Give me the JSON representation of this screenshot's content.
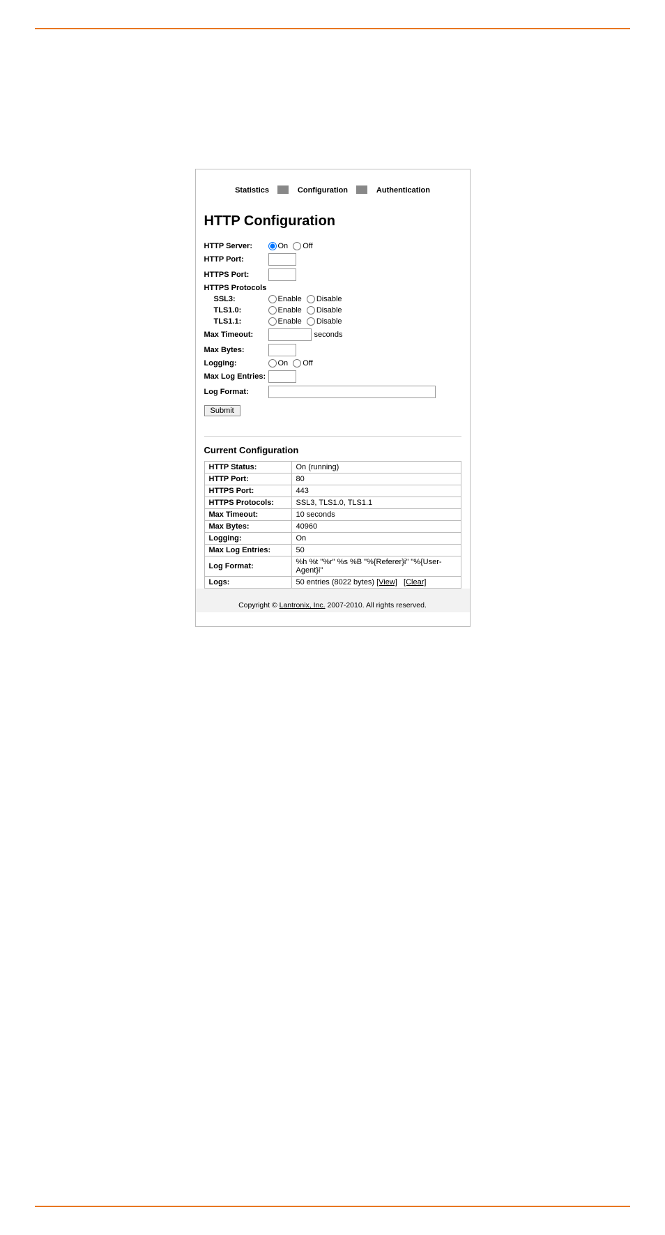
{
  "tabs": {
    "t1": "Statistics",
    "t2": "Configuration",
    "t3": "Authentication"
  },
  "heading": "HTTP Configuration",
  "form": {
    "http_server": {
      "label": "HTTP Server:",
      "on": "On",
      "off": "Off"
    },
    "http_port": {
      "label": "HTTP Port:",
      "value": ""
    },
    "https_port": {
      "label": "HTTPS Port:",
      "value": ""
    },
    "https_protocols": {
      "label": "HTTPS Protocols"
    },
    "ssl3": {
      "label": "SSL3:",
      "enable": "Enable",
      "disable": "Disable"
    },
    "tls10": {
      "label": "TLS1.0:",
      "enable": "Enable",
      "disable": "Disable"
    },
    "tls11": {
      "label": "TLS1.1:",
      "enable": "Enable",
      "disable": "Disable"
    },
    "max_timeout": {
      "label": "Max Timeout:",
      "value": "",
      "suffix": "seconds"
    },
    "max_bytes": {
      "label": "Max Bytes:",
      "value": ""
    },
    "logging": {
      "label": "Logging:",
      "on": "On",
      "off": "Off"
    },
    "max_log_entries": {
      "label": "Max Log Entries:",
      "value": ""
    },
    "log_format": {
      "label": "Log Format:",
      "value": ""
    },
    "submit": "Submit"
  },
  "current": {
    "heading": "Current Configuration",
    "rows": {
      "http_status": {
        "k": "HTTP Status:",
        "v": "On (running)"
      },
      "http_port": {
        "k": "HTTP Port:",
        "v": "80"
      },
      "https_port": {
        "k": "HTTPS Port:",
        "v": "443"
      },
      "https_protocols": {
        "k": "HTTPS Protocols:",
        "v": "SSL3, TLS1.0, TLS1.1"
      },
      "max_timeout": {
        "k": "Max Timeout:",
        "v": "10 seconds"
      },
      "max_bytes": {
        "k": "Max Bytes:",
        "v": "40960"
      },
      "logging": {
        "k": "Logging:",
        "v": "On"
      },
      "max_log_entries": {
        "k": "Max Log Entries:",
        "v": "50"
      },
      "log_format": {
        "k": "Log Format:",
        "v": "%h %t \"%r\" %s %B \"%{Referer}i\" \"%{User-Agent}i\""
      },
      "logs": {
        "k": "Logs:",
        "prefix": "50 entries (8022 bytes)  ",
        "view": "[View]",
        "clear": "[Clear]"
      }
    }
  },
  "footer": {
    "pre": "Copyright © ",
    "link": "Lantronix, Inc.",
    "post": " 2007-2010. All rights reserved."
  }
}
